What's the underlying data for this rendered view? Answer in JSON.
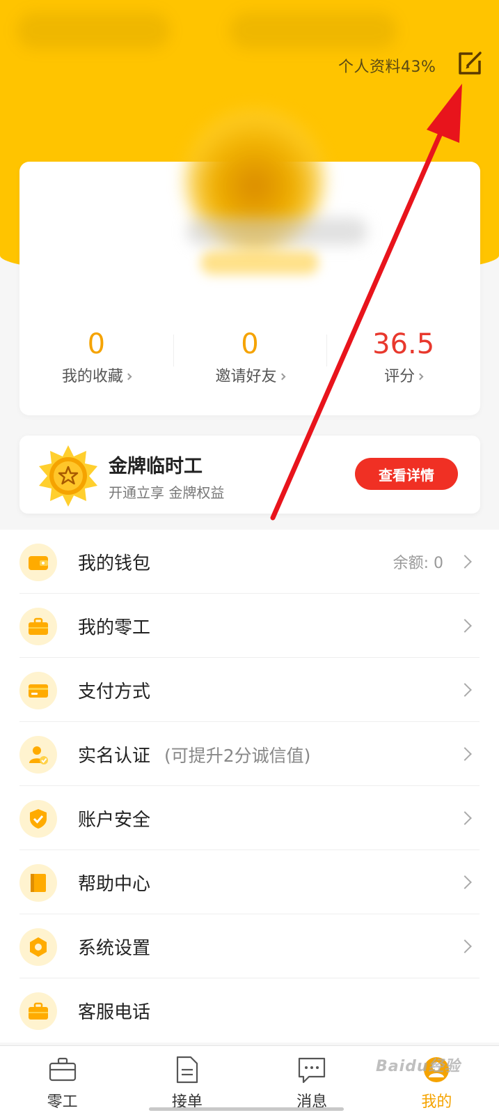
{
  "header": {
    "profile_completion": "个人资料43%",
    "edit_icon": "edit-icon"
  },
  "profile": {
    "stats": [
      {
        "value": "0",
        "label": "我的收藏"
      },
      {
        "value": "0",
        "label": "邀请好友"
      },
      {
        "value": "36.5",
        "label": "评分"
      }
    ]
  },
  "gold": {
    "title": "金牌临时工",
    "subtitle": "开通立享 金牌权益",
    "button_label": "查看详情"
  },
  "menu": {
    "items": [
      {
        "label": "我的钱包",
        "icon": "wallet-icon",
        "extra": "余额: 0"
      },
      {
        "label": "我的零工",
        "icon": "briefcase-icon"
      },
      {
        "label": "支付方式",
        "icon": "card-icon"
      },
      {
        "label": "实名认证",
        "icon": "id-verify-icon",
        "note": "(可提升2分诚信值)"
      },
      {
        "label": "账户安全",
        "icon": "shield-icon"
      },
      {
        "label": "帮助中心",
        "icon": "book-icon"
      },
      {
        "label": "系统设置",
        "icon": "gear-icon"
      },
      {
        "label": "客服电话",
        "icon": "briefcase-icon"
      }
    ]
  },
  "tabbar": {
    "tabs": [
      {
        "label": "零工",
        "icon": "briefcase-icon"
      },
      {
        "label": "接单",
        "icon": "document-icon"
      },
      {
        "label": "消息",
        "icon": "chat-icon"
      },
      {
        "label": "我的",
        "icon": "profile-icon",
        "active": true
      }
    ]
  },
  "watermark": "Baidu经验",
  "colors": {
    "header": "#ffc400",
    "accent": "#f5a300",
    "score": "#e8382d",
    "button": "#f03024",
    "annotation_arrow": "#e8141c"
  }
}
